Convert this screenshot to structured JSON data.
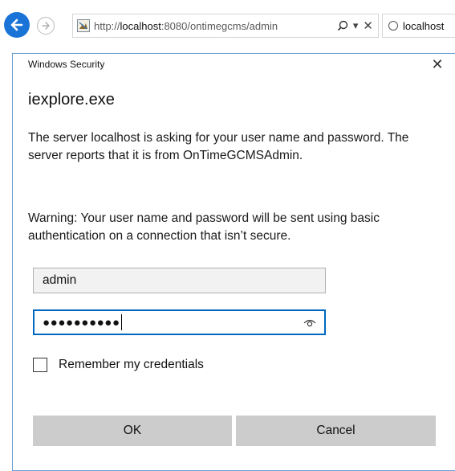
{
  "browser": {
    "url_prefix": "http://",
    "url_host": "localhost",
    "url_rest": ":8080/ontimegcms/admin",
    "search_glyph": "⌕",
    "dropdown_glyph": "▾",
    "close_glyph": "✕",
    "tab_title": "localhost",
    "icons": {
      "back": "back-arrow-icon",
      "forward": "forward-arrow-icon",
      "site": "site-favicon-icon",
      "search": "search-icon",
      "dropdown": "chevron-down-icon",
      "close": "close-icon",
      "tab_loading": "loading-spinner-icon"
    },
    "accent_color": "#1a73d6"
  },
  "dialog": {
    "caption": "Windows Security",
    "close_glyph": "✕",
    "title": "iexplore.exe",
    "message1": "The server localhost is asking for your user name and password. The server reports that it is from OnTimeGCMSAdmin.",
    "message2": "Warning: Your user name and password will be sent using basic authentication on a connection that isn’t secure.",
    "username_value": "admin",
    "password_mask": "●●●●●●●●●●",
    "remember_label": "Remember my credentials",
    "remember_checked": false,
    "ok_label": "OK",
    "cancel_label": "Cancel",
    "icons": {
      "reveal_password": "eye-icon",
      "close": "close-icon"
    },
    "focus_color": "#0067c0",
    "button_color": "#cccccc"
  }
}
